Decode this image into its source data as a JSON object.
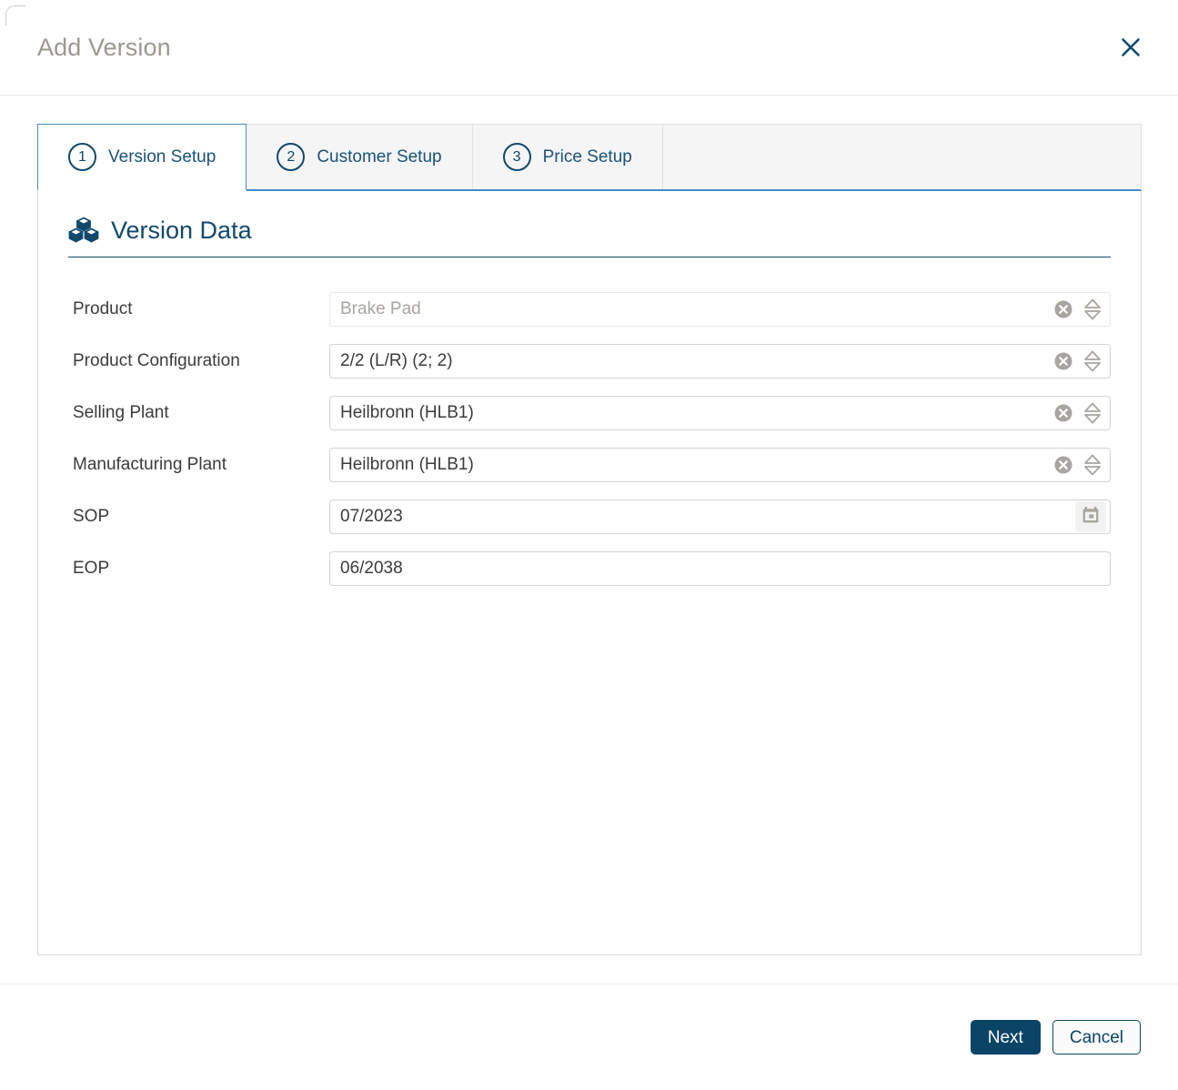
{
  "dialog": {
    "title": "Add Version",
    "close_icon": "close-icon"
  },
  "tabs": [
    {
      "step": "1",
      "label": "Version Setup",
      "active": true
    },
    {
      "step": "2",
      "label": "Customer Setup",
      "active": false
    },
    {
      "step": "3",
      "label": "Price Setup",
      "active": false
    }
  ],
  "section": {
    "icon": "cubes-icon",
    "title": "Version Data"
  },
  "fields": [
    {
      "label": "Product",
      "value": "Brake Pad",
      "readonly": true,
      "icons": [
        "clear-icon",
        "value-help-stepper-icon"
      ]
    },
    {
      "label": "Product Configuration",
      "value": "2/2 (L/R) (2; 2)",
      "readonly": false,
      "icons": [
        "clear-icon",
        "value-help-stepper-icon"
      ]
    },
    {
      "label": "Selling Plant",
      "value": "Heilbronn (HLB1)",
      "readonly": false,
      "icons": [
        "clear-icon",
        "value-help-stepper-icon"
      ]
    },
    {
      "label": "Manufacturing Plant",
      "value": "Heilbronn (HLB1)",
      "readonly": false,
      "icons": [
        "clear-icon",
        "value-help-stepper-icon"
      ]
    },
    {
      "label": "SOP",
      "value": "07/2023",
      "readonly": false,
      "icons": [
        "calendar-icon"
      ]
    },
    {
      "label": "EOP",
      "value": "06/2038",
      "readonly": false,
      "icons": []
    }
  ],
  "footer": {
    "next_label": "Next",
    "cancel_label": "Cancel"
  },
  "colors": {
    "brand_dark_blue": "#12486b",
    "primary_button": "#0a4466",
    "tab_active_border": "#4a8cc7",
    "title_gray": "#9b9890",
    "icon_gray": "#a8a5a0"
  }
}
